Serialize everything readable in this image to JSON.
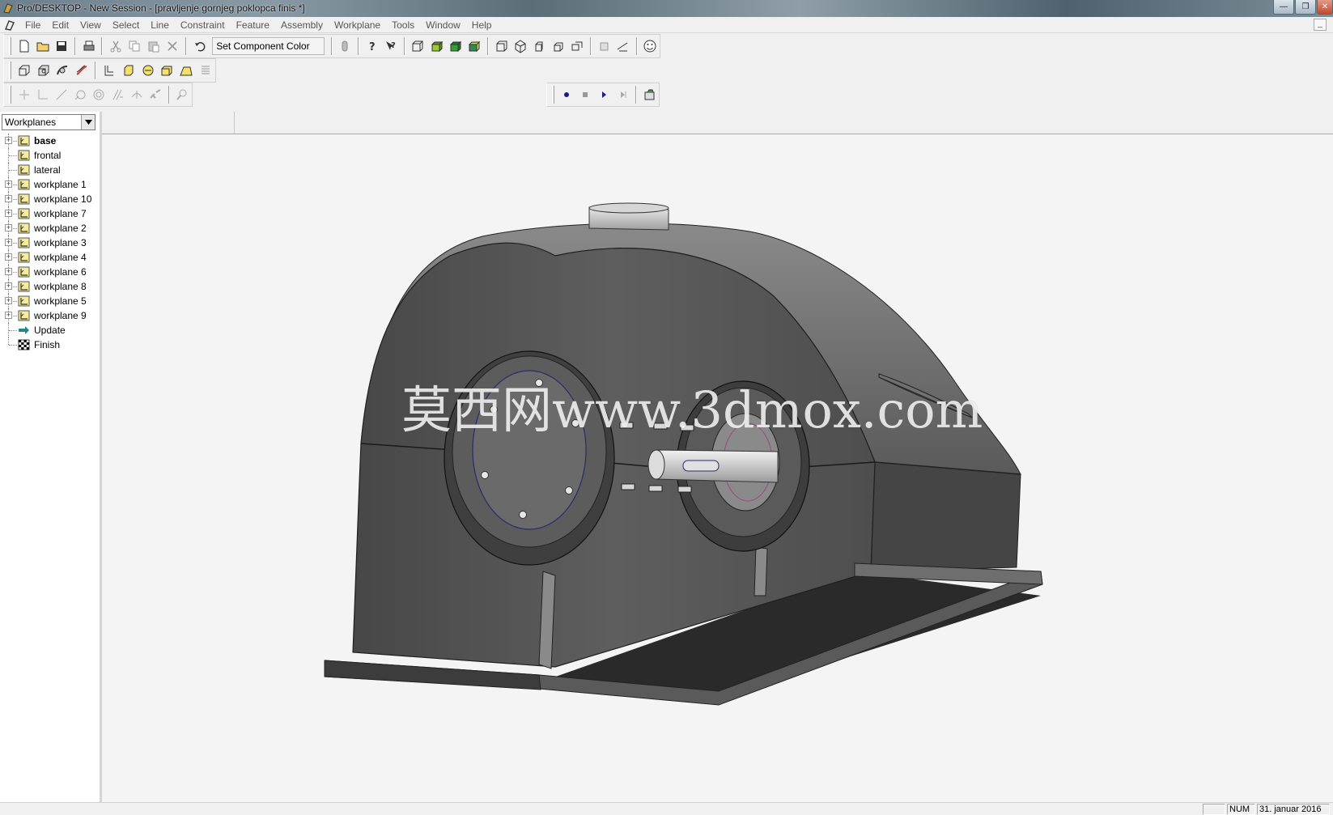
{
  "window": {
    "title": "Pro/DESKTOP - New Session - [pravljenje gornjeg poklopca finis *]",
    "min_label": "—",
    "max_label": "❐",
    "close_label": "✕"
  },
  "menubar": {
    "items": [
      "File",
      "Edit",
      "View",
      "Select",
      "Line",
      "Constraint",
      "Feature",
      "Assembly",
      "Workplane",
      "Tools",
      "Window",
      "Help"
    ],
    "mdi_min_label": "_"
  },
  "toolbar": {
    "component_color_combo": "Set Component Color"
  },
  "browser": {
    "selector_value": "Workplanes",
    "tree": [
      {
        "label": "base",
        "bold": true,
        "expandable": true,
        "icon": "workplane-icon"
      },
      {
        "label": "frontal",
        "bold": false,
        "expandable": false,
        "icon": "workplane-icon"
      },
      {
        "label": "lateral",
        "bold": false,
        "expandable": false,
        "icon": "workplane-icon"
      },
      {
        "label": "workplane 1",
        "bold": false,
        "expandable": true,
        "icon": "workplane-icon"
      },
      {
        "label": "workplane 10",
        "bold": false,
        "expandable": true,
        "icon": "workplane-icon"
      },
      {
        "label": "workplane 7",
        "bold": false,
        "expandable": true,
        "icon": "workplane-icon"
      },
      {
        "label": "workplane 2",
        "bold": false,
        "expandable": true,
        "icon": "workplane-icon"
      },
      {
        "label": "workplane 3",
        "bold": false,
        "expandable": true,
        "icon": "workplane-icon"
      },
      {
        "label": "workplane 4",
        "bold": false,
        "expandable": true,
        "icon": "workplane-icon"
      },
      {
        "label": "workplane 6",
        "bold": false,
        "expandable": true,
        "icon": "workplane-icon"
      },
      {
        "label": "workplane 8",
        "bold": false,
        "expandable": true,
        "icon": "workplane-icon"
      },
      {
        "label": "workplane 5",
        "bold": false,
        "expandable": true,
        "icon": "workplane-icon"
      },
      {
        "label": "workplane 9",
        "bold": false,
        "expandable": true,
        "icon": "workplane-icon"
      },
      {
        "label": "Update",
        "bold": false,
        "expandable": false,
        "icon": "update-arrow-icon"
      },
      {
        "label": "Finish",
        "bold": false,
        "expandable": false,
        "icon": "finish-flag-icon"
      }
    ]
  },
  "viewport": {
    "watermark": "莫西网www.3dmox.com",
    "model_color": "#5a5a5a"
  },
  "statusbar": {
    "cell1": "",
    "num": "NUM",
    "date": "31. januar 2016"
  }
}
